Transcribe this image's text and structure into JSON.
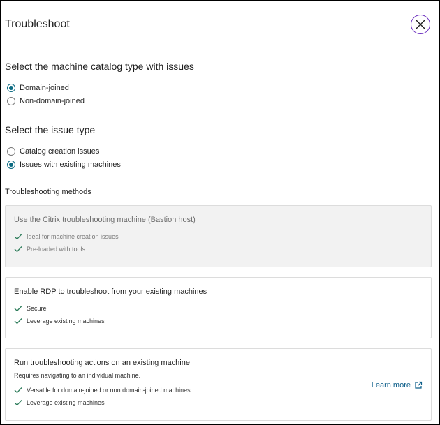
{
  "header": {
    "title": "Troubleshoot"
  },
  "catalog_section": {
    "heading": "Select the machine catalog type with issues",
    "options": [
      {
        "label": "Domain-joined",
        "selected": true
      },
      {
        "label": "Non-domain-joined",
        "selected": false
      }
    ]
  },
  "issue_section": {
    "heading": "Select the issue type",
    "options": [
      {
        "label": "Catalog creation issues",
        "selected": false
      },
      {
        "label": "Issues with existing machines",
        "selected": true
      }
    ]
  },
  "methods": {
    "heading": "Troubleshooting methods",
    "cards": [
      {
        "title": "Use the Citrix troubleshooting machine (Bastion host)",
        "disabled": true,
        "features": [
          "Ideal for machine creation issues",
          "Pre-loaded with tools"
        ]
      },
      {
        "title": "Enable RDP to troubleshoot from your existing machines",
        "disabled": false,
        "features": [
          "Secure",
          "Leverage existing machines"
        ]
      },
      {
        "title": "Run troubleshooting actions on an existing machine",
        "subtitle": "Requires navigating to an individual machine.",
        "disabled": false,
        "features": [
          "Versatile for domain-joined or non domain-joined machines",
          "Leverage existing machines"
        ],
        "link": "Learn more"
      }
    ]
  },
  "colors": {
    "accent": "#0c6b82",
    "link": "#0e5f8a",
    "check": "#2e7d5b",
    "close_ring": "#6b2fbf"
  },
  "icons": {
    "close": "close-icon",
    "check": "check-icon",
    "external": "external-link-icon"
  }
}
